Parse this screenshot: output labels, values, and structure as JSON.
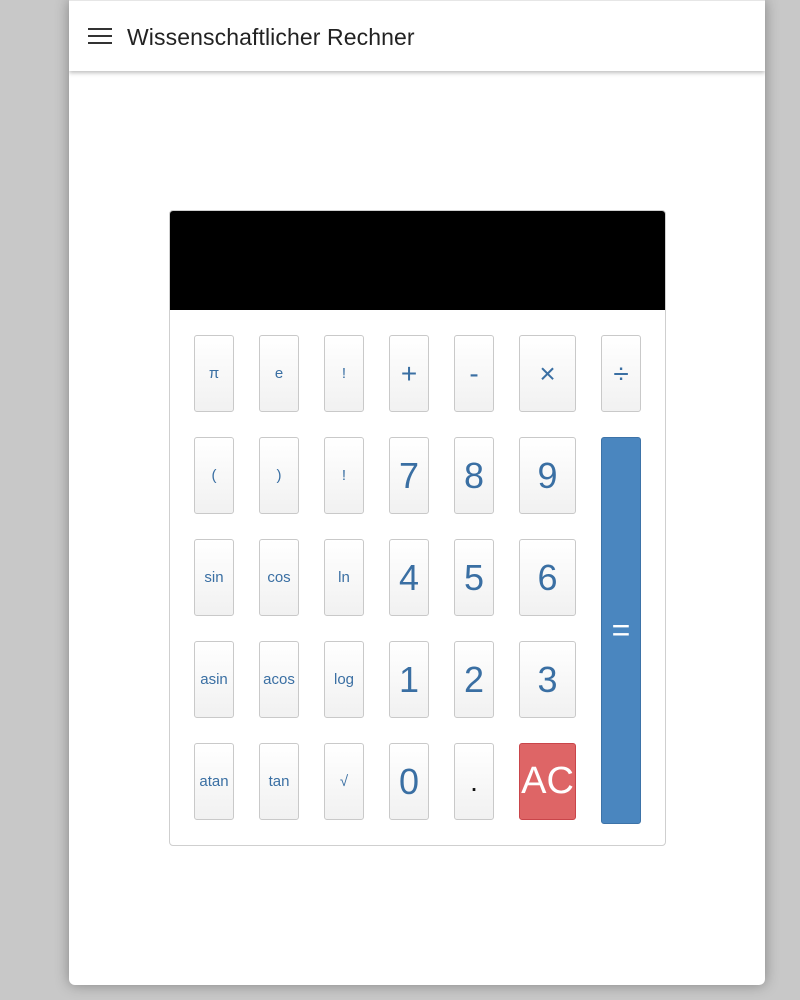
{
  "app": {
    "title": "Wissenschaftlicher Rechner"
  },
  "display": {
    "value": ""
  },
  "keys": {
    "pi": "π",
    "e": "e",
    "fact1": "!",
    "plus": "+",
    "minus": "-",
    "times": "×",
    "divide": "÷",
    "lparen": "(",
    "rparen": ")",
    "fact2": "!",
    "seven": "7",
    "eight": "8",
    "nine": "9",
    "sin": "sin",
    "cos": "cos",
    "ln": "ln",
    "four": "4",
    "five": "5",
    "six": "6",
    "asin": "asin",
    "acos": "acos",
    "log": "log",
    "one": "1",
    "two": "2",
    "three": "3",
    "atan": "atan",
    "tan": "tan",
    "sqrt": "√",
    "zero": "0",
    "dot": ".",
    "ac": "AC",
    "equals": "="
  },
  "colors": {
    "key_text": "#3a6fa3",
    "clear_button": "#de6566",
    "equals_button": "#4a86bf",
    "display_bg": "#000000"
  }
}
